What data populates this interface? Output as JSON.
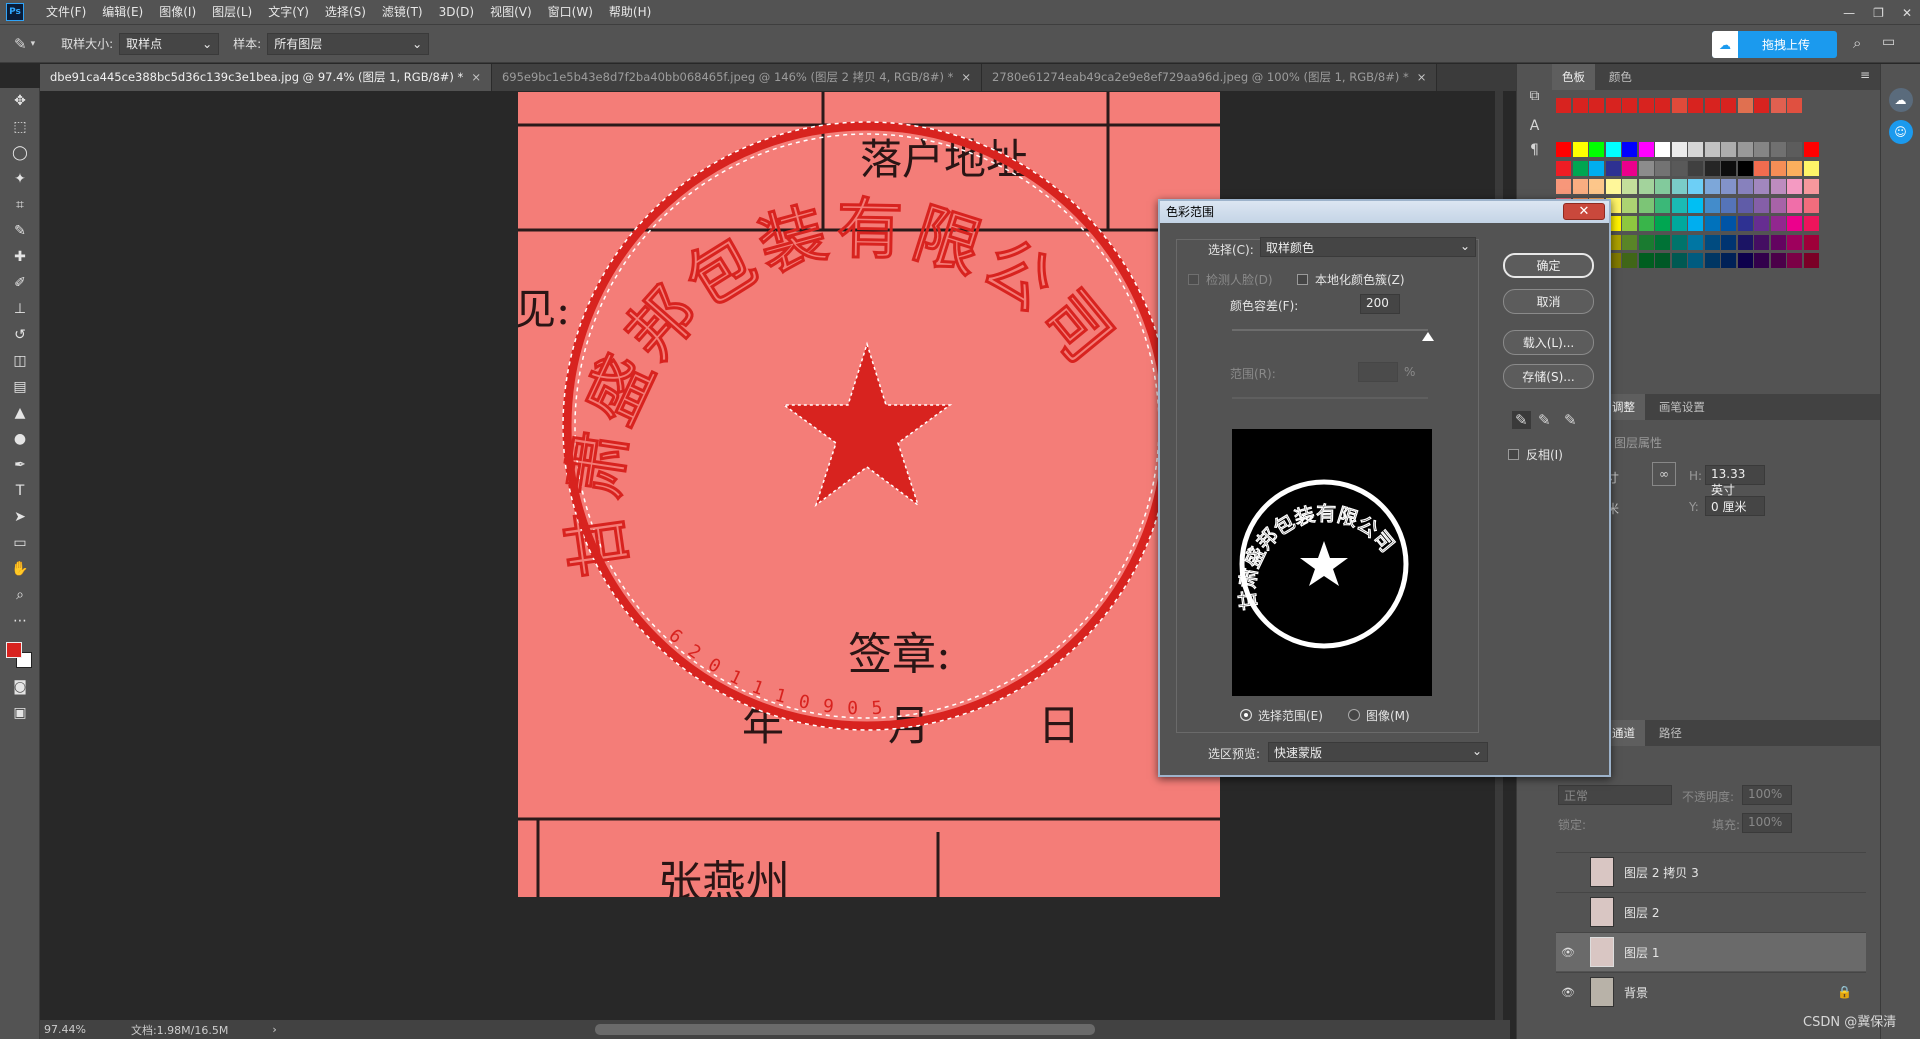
{
  "app": {
    "logo": "Ps"
  },
  "menu": [
    "文件(F)",
    "编辑(E)",
    "图像(I)",
    "图层(L)",
    "文字(Y)",
    "选择(S)",
    "滤镜(T)",
    "3D(D)",
    "视图(V)",
    "窗口(W)",
    "帮助(H)"
  ],
  "options": {
    "sample_size_label": "取样大小:",
    "sample_size_value": "取样点",
    "sample_label": "样本:",
    "sample_value": "所有图层",
    "upload_label": "拖拽上传"
  },
  "tabs": [
    {
      "label": "dbe91ca445ce388bc5d36c139c3e1bea.jpg @ 97.4% (图层 1, RGB/8#) *",
      "close": "×"
    },
    {
      "label": "695e9bc1e5b43e8d7f2ba40bb068465f.jpeg @ 146% (图层 2 拷贝 4, RGB/8#) *",
      "close": "×"
    },
    {
      "label": "2780e61274eab49ca2e9e8ef729aa96d.jpeg @ 100% (图层 1, RGB/8#) *",
      "close": "×"
    }
  ],
  "document": {
    "texts": [
      "落户地址",
      "见:",
      "签章:",
      "年",
      "月",
      "日",
      "张燕州"
    ],
    "seal_text": "甘肃盛邦包装有限公司",
    "seal_number": "6201110905"
  },
  "status": {
    "zoom": "97.44%",
    "doc_info": "文档:1.98M/16.5M"
  },
  "color_panel": {
    "tabs": [
      "色板",
      "颜色"
    ]
  },
  "props_panel": {
    "tabs": [
      "调整",
      "画笔设置"
    ],
    "title": "图层属性",
    "h_label": "H:",
    "h_value": "13.33 英寸",
    "y_label": "Y:",
    "y_value": "0 厘米",
    "w_unit": "寸",
    "x_unit": "米"
  },
  "layers_panel": {
    "tabs": [
      "通道",
      "路径"
    ],
    "blend_mode": "正常",
    "opacity_label": "不透明度:",
    "opacity_value": "100%",
    "lock_label": "锁定:",
    "fill_label": "填充:",
    "fill_value": "100%",
    "layers": [
      {
        "name": "图层 2 拷贝 3",
        "visible": false
      },
      {
        "name": "图层 2",
        "visible": false
      },
      {
        "name": "图层 1",
        "visible": true,
        "selected": true
      },
      {
        "name": "背景",
        "visible": true,
        "locked": true
      }
    ]
  },
  "dialog": {
    "title": "色彩范围",
    "select_label": "选择(C):",
    "select_value": "取样颜色",
    "detect_faces": "检测人脸(D)",
    "localized": "本地化颜色簇(Z)",
    "fuzziness_label": "颜色容差(F):",
    "fuzziness_value": "200",
    "fuzziness_slider": 1.0,
    "range_label": "范围(R):",
    "range_unit": "%",
    "ok": "确定",
    "cancel": "取消",
    "load": "载入(L)...",
    "save": "存储(S)...",
    "invert": "反相(I)",
    "radio_selection": "选择范围(E)",
    "radio_image": "图像(M)",
    "preview_label": "选区预览:",
    "preview_value": "快速蒙版"
  },
  "watermark": "CSDN @冀保清",
  "colors": {
    "accent": "#1b9aee",
    "canvas_red": "#f47d78",
    "seal_red": "#d8231f"
  }
}
